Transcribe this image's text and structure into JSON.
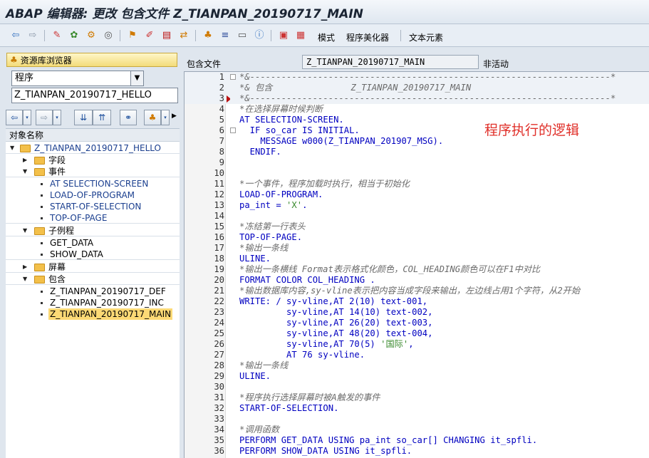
{
  "window": {
    "title": "ABAP 编辑器: 更改 包含文件 Z_TIANPAN_20190717_MAIN"
  },
  "toolbar": {
    "icons": [
      "back-arrow-icon",
      "forward-arrow-icon",
      "check-icon",
      "activate-icon",
      "test-icon",
      "where-used-icon",
      "hierarchy-icon",
      "edit-icon",
      "stack-icon",
      "move-icon",
      "tree-icon",
      "align-icon",
      "display-icon",
      "info-icon",
      "insert-pattern-icon",
      "pretty-print-icon"
    ],
    "mode_label": "模式",
    "pretty_printer_label": "程序美化器",
    "text_elements_label": "文本元素"
  },
  "left_panel": {
    "repo_browser_label": "资源库浏览器",
    "object_type": "程序",
    "object_name": "Z_TIANPAN_20190717_HELLO",
    "tree_header": "对象名称",
    "tree": [
      {
        "label": "Z_TIANPAN_20190717_HELLO",
        "type": "folder",
        "level": 0,
        "expanded": true
      },
      {
        "label": "字段",
        "type": "folder",
        "level": 1,
        "expanded": false
      },
      {
        "label": "事件",
        "type": "folder",
        "level": 1,
        "expanded": true
      },
      {
        "label": "AT SELECTION-SCREEN",
        "type": "leaf",
        "level": 2
      },
      {
        "label": "LOAD-OF-PROGRAM",
        "type": "leaf",
        "level": 2
      },
      {
        "label": "START-OF-SELECTION",
        "type": "leaf",
        "level": 2
      },
      {
        "label": "TOP-OF-PAGE",
        "type": "leaf",
        "level": 2
      },
      {
        "label": "子例程",
        "type": "folder",
        "level": 1,
        "expanded": true
      },
      {
        "label": "GET_DATA",
        "type": "leaf",
        "level": 2
      },
      {
        "label": "SHOW_DATA",
        "type": "leaf",
        "level": 2
      },
      {
        "label": "屏幕",
        "type": "folder",
        "level": 1,
        "expanded": false
      },
      {
        "label": "包含",
        "type": "folder",
        "level": 1,
        "expanded": true
      },
      {
        "label": "Z_TIANPAN_20190717_DEF",
        "type": "leaf",
        "level": 2
      },
      {
        "label": "Z_TIANPAN_20190717_INC",
        "type": "leaf",
        "level": 2
      },
      {
        "label": "Z_TIANPAN_20190717_MAIN",
        "type": "leaf",
        "level": 2,
        "selected": true
      }
    ]
  },
  "editor": {
    "include_label": "包含文件",
    "include_name": "Z_TIANPAN_20190717_MAIN",
    "status": "非活动",
    "annotation": "程序执行的逻辑",
    "lines": [
      {
        "n": "1",
        "text": "*&---------------------------------------------------------------------*",
        "style": "comment"
      },
      {
        "n": "2",
        "text": "*& 包含               Z_TIANPAN_20190717_MAIN",
        "style": "comment"
      },
      {
        "n": "3",
        "text": "*&---------------------------------------------------------------------*",
        "style": "comment"
      },
      {
        "n": "4",
        "text": "*在选择屏幕时候判断",
        "style": "comment"
      },
      {
        "n": "5",
        "text": "AT SELECTION-SCREEN.",
        "style": "code"
      },
      {
        "n": "6",
        "text": "  IF so_car IS INITIAL.",
        "style": "code"
      },
      {
        "n": "7",
        "text": "    MESSAGE w000(Z_TIANPAN_201907_MSG).",
        "style": "code"
      },
      {
        "n": "8",
        "text": "  ENDIF.",
        "style": "code"
      },
      {
        "n": "9",
        "text": "",
        "style": "code"
      },
      {
        "n": "10",
        "text": "",
        "style": "code"
      },
      {
        "n": "11",
        "text": "*一个事件，程序加载时执行，相当于初始化",
        "style": "comment"
      },
      {
        "n": "12",
        "text": "LOAD-OF-PROGRAM.",
        "style": "code"
      },
      {
        "n": "13",
        "text": "pa_int = 'X'.",
        "style": "code"
      },
      {
        "n": "14",
        "text": "",
        "style": "code"
      },
      {
        "n": "15",
        "text": "*冻结第一行表头",
        "style": "comment"
      },
      {
        "n": "16",
        "text": "TOP-OF-PAGE.",
        "style": "code"
      },
      {
        "n": "17",
        "text": "*输出一条线",
        "style": "comment"
      },
      {
        "n": "18",
        "text": "ULINE.",
        "style": "code"
      },
      {
        "n": "19",
        "text": "*输出一条横线 Format表示格式化颜色，COL_HEADING颜色可以在F1中对比",
        "style": "comment"
      },
      {
        "n": "20",
        "text": "FORMAT COLOR COL_HEADING .",
        "style": "code"
      },
      {
        "n": "21",
        "text": "*输出数据库内容,sy-vline表示把内容当成字段来输出，左边线占用1个字符，从2开始",
        "style": "comment"
      },
      {
        "n": "22",
        "text": "WRITE: / sy-vline,AT 2(10) text-001,",
        "style": "code"
      },
      {
        "n": "23",
        "text": "         sy-vline,AT 14(10) text-002,",
        "style": "code"
      },
      {
        "n": "24",
        "text": "         sy-vline,AT 26(20) text-003,",
        "style": "code"
      },
      {
        "n": "25",
        "text": "         sy-vline,AT 48(20) text-004,",
        "style": "code"
      },
      {
        "n": "26",
        "text": "         sy-vline,AT 70(5) '国际',",
        "style": "code"
      },
      {
        "n": "27",
        "text": "         AT 76 sy-vline.",
        "style": "code"
      },
      {
        "n": "28",
        "text": "*输出一条线",
        "style": "comment"
      },
      {
        "n": "29",
        "text": "ULINE.",
        "style": "code"
      },
      {
        "n": "30",
        "text": "",
        "style": "code"
      },
      {
        "n": "31",
        "text": "*程序执行选择屏幕时被A触发的事件",
        "style": "comment"
      },
      {
        "n": "32",
        "text": "START-OF-SELECTION.",
        "style": "code"
      },
      {
        "n": "33",
        "text": "",
        "style": "code"
      },
      {
        "n": "34",
        "text": "*调用函数",
        "style": "comment"
      },
      {
        "n": "35",
        "text": "PERFORM GET_DATA USING pa_int so_car[] CHANGING it_spfli.",
        "style": "code"
      },
      {
        "n": "36",
        "text": "PERFORM SHOW_DATA USING it_spfli.",
        "style": "code"
      }
    ]
  }
}
